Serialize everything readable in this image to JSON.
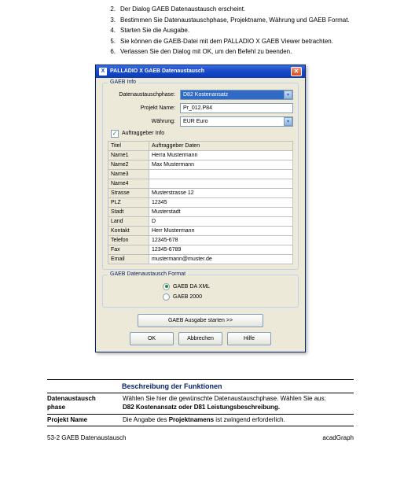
{
  "steps": [
    {
      "n": "2.",
      "t": "Der Dialog GAEB Datenaustausch erscheint."
    },
    {
      "n": "3.",
      "t": "Bestimmen Sie Datenaustauschphase, Projektname, Währung und GAEB Format."
    },
    {
      "n": "4.",
      "t": "Starten Sie die Ausgabe."
    },
    {
      "n": "5.",
      "t": "Sie können die GAEB-Datei mit dem PALLADIO X GAEB Viewer betrachten."
    },
    {
      "n": "6.",
      "t": "Verlassen Sie den Dialog mit OK, um den Befehl zu beenden."
    }
  ],
  "dialog": {
    "title": "PALLADIO X  GAEB Datenaustausch",
    "groups": {
      "info": {
        "title": "GAEB Info",
        "rows": {
          "phase_label": "Datenaustauschphase:",
          "phase_value": "D82   Kostenansatz",
          "project_label": "Projekt Name:",
          "project_value": "Pr_012.P84",
          "currency_label": "Währung:",
          "currency_value": "EUR Euro"
        }
      },
      "auftraggeber": {
        "check_label": "Auftraggeber Info",
        "header_col1": "Titel",
        "header_col2": "Auftraggeber Daten",
        "rows": [
          {
            "k": "Name1",
            "v": "Herra Mustermann"
          },
          {
            "k": "Name2",
            "v": "Max Mustermann"
          },
          {
            "k": "Name3",
            "v": ""
          },
          {
            "k": "Name4",
            "v": ""
          },
          {
            "k": "Strasse",
            "v": "Musterstrasse 12"
          },
          {
            "k": "PLZ",
            "v": "12345"
          },
          {
            "k": "Stadt",
            "v": "Musterstadt"
          },
          {
            "k": "Land",
            "v": "D"
          },
          {
            "k": "Kontakt",
            "v": "Herr Mustermann"
          },
          {
            "k": "Telefon",
            "v": "12345-678"
          },
          {
            "k": "Fax",
            "v": "12345-6789"
          },
          {
            "k": "Email",
            "v": "mustermann@muster.de"
          }
        ]
      },
      "format": {
        "title": "GAEB Datenaustausch Format",
        "opt1": "GAEB DA XML",
        "opt2": "GAEB 2000"
      }
    },
    "start_button": "GAEB Ausgabe starten    >>",
    "buttons": {
      "ok": "OK",
      "cancel": "Abbrechen",
      "help": "Hilfe"
    }
  },
  "desc": {
    "heading": "Beschreibung der Funktionen",
    "row1": {
      "label1": "Datenaustausch",
      "label2": "phase",
      "text_a": "Wählen Sie hier die gewünschte Datenaustauschphase. Wählen Sie aus:",
      "text_b_pre": "",
      "text_b_bold": "D82 Kostenansatz oder D81 Leistungsbeschreibung.",
      "text_b_post": ""
    },
    "row2": {
      "label": "Projekt Name",
      "text_pre": "Die Angabe des ",
      "text_bold": "Projektnamens",
      "text_post": " ist zwingend erforderlich."
    }
  },
  "footer": {
    "left": "53-2   GAEB Datenaustausch",
    "right": "acadGraph"
  }
}
